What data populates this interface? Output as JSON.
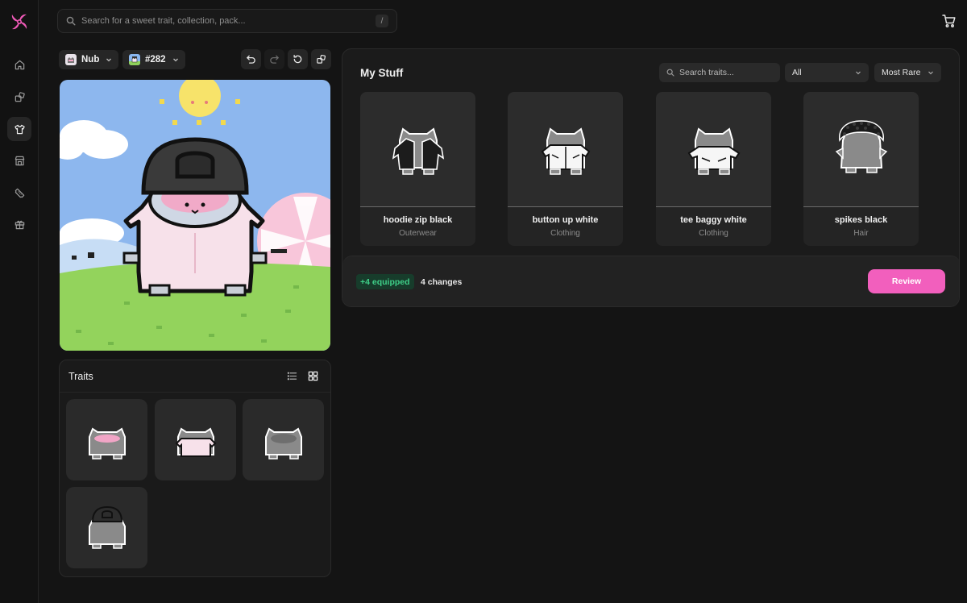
{
  "search": {
    "placeholder": "Search for a sweet trait, collection, pack...",
    "shortcut": "/"
  },
  "sidebar": {
    "items": [
      {
        "name": "home",
        "icon": "home-icon",
        "active": false
      },
      {
        "name": "packs",
        "icon": "packs-icon",
        "active": false
      },
      {
        "name": "wardrobe",
        "icon": "shirt-icon",
        "active": true
      },
      {
        "name": "market",
        "icon": "store-icon",
        "active": false
      },
      {
        "name": "collectibles",
        "icon": "ticket-icon",
        "active": false
      },
      {
        "name": "gifts",
        "icon": "gift-icon",
        "active": false
      }
    ]
  },
  "toolbar": {
    "collection_label": "Nub",
    "token_label": "#282",
    "tools": [
      "undo-icon",
      "redo-icon",
      "reset-icon",
      "share-icon"
    ]
  },
  "traits": {
    "title": "Traits",
    "view_modes": [
      "list-icon",
      "grid-icon"
    ],
    "active_view": "grid"
  },
  "my_stuff": {
    "title": "My Stuff",
    "search_placeholder": "Search traits...",
    "filter_value": "All",
    "sort_value": "Most Rare",
    "items": [
      {
        "name": "hoodie zip black",
        "category": "Outerwear"
      },
      {
        "name": "button up white",
        "category": "Clothing"
      },
      {
        "name": "tee baggy white",
        "category": "Clothing"
      },
      {
        "name": "spikes black",
        "category": "Hair"
      }
    ]
  },
  "summary": {
    "equipped": "+4 equipped",
    "changes": "4 changes",
    "review_label": "Review"
  },
  "colors": {
    "accent": "#f25fbd",
    "success": "#3fcf88",
    "background": "#141414"
  }
}
